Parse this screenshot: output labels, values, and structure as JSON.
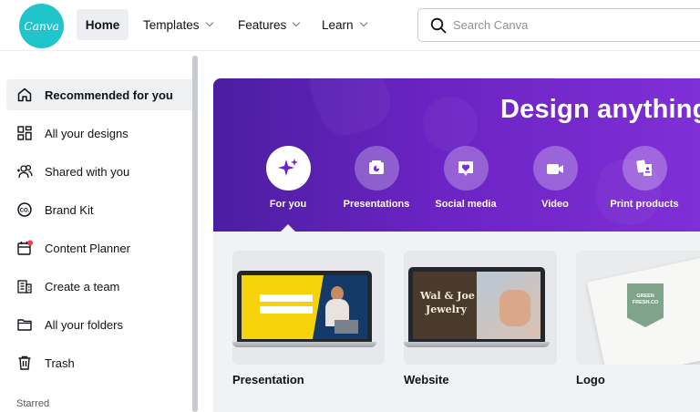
{
  "topbar": {
    "logo_text": "Canva",
    "nav": [
      {
        "label": "Home",
        "has_dropdown": false,
        "active": true
      },
      {
        "label": "Templates",
        "has_dropdown": true
      },
      {
        "label": "Features",
        "has_dropdown": true
      },
      {
        "label": "Learn",
        "has_dropdown": true
      }
    ],
    "search": {
      "placeholder": "Search Canva",
      "value": "",
      "icon": "search-icon"
    }
  },
  "sidebar": {
    "items": [
      {
        "label": "Recommended for you",
        "icon": "home-icon",
        "active": true
      },
      {
        "label": "All your designs",
        "icon": "grid-icon"
      },
      {
        "label": "Shared with you",
        "icon": "people-add-icon"
      },
      {
        "label": "Brand Kit",
        "icon": "brand-kit-icon"
      },
      {
        "label": "Content Planner",
        "icon": "calendar-icon",
        "notification_dot": true
      },
      {
        "label": "Create a team",
        "icon": "team-building-icon"
      },
      {
        "label": "All your folders",
        "icon": "folder-icon"
      },
      {
        "label": "Trash",
        "icon": "trash-icon"
      }
    ],
    "section_heading": "Starred"
  },
  "hero": {
    "title": "Design anything",
    "categories": [
      {
        "label": "For you",
        "icon": "sparkle-icon",
        "active": true
      },
      {
        "label": "Presentations",
        "icon": "presentation-icon"
      },
      {
        "label": "Social media",
        "icon": "heart-icon"
      },
      {
        "label": "Video",
        "icon": "video-camera-icon"
      },
      {
        "label": "Print products",
        "icon": "print-products-icon"
      }
    ]
  },
  "recommendations": [
    {
      "label": "Presentation"
    },
    {
      "label": "Website",
      "thumbnail_text": [
        "Wal & Joe",
        "Jewelry"
      ]
    },
    {
      "label": "Logo",
      "thumbnail_text": [
        "GREEN",
        "FRESH.CO"
      ]
    }
  ],
  "colors": {
    "brand": "#20c4cb",
    "hero_purple_start": "#4b1ea1",
    "hero_purple_end": "#7f2fd6",
    "notification": "#ff3b4f"
  }
}
